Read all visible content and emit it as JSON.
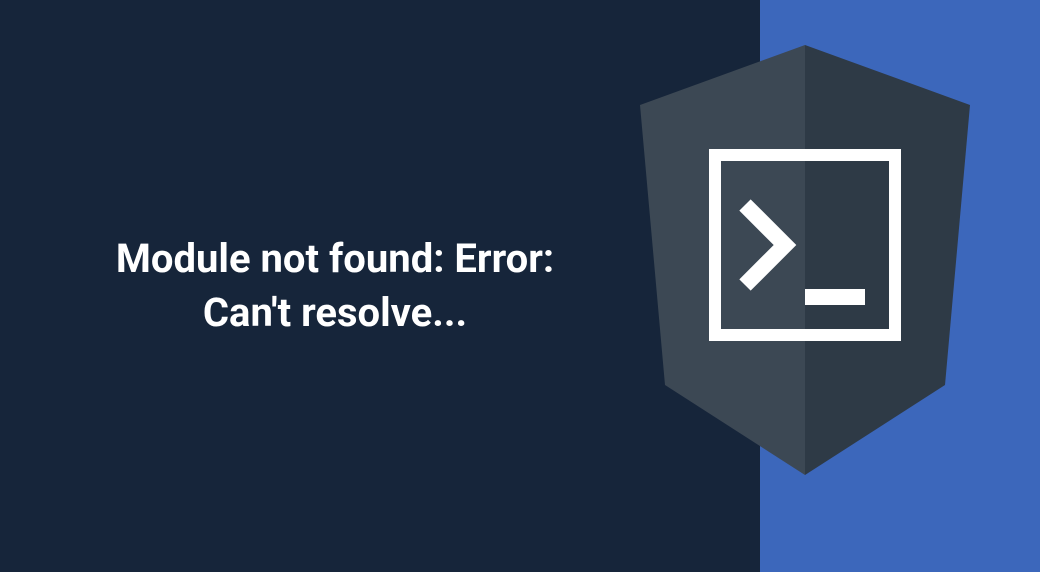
{
  "heading": {
    "line1": "Module not found: Error:",
    "line2": "Can't resolve..."
  },
  "colors": {
    "dark_bg": "#16253a",
    "blue_bg": "#3c67bb",
    "shield_left": "#3c4854",
    "shield_right": "#2e3a46",
    "icon_stroke": "#ffffff"
  },
  "icon": {
    "name": "terminal-icon"
  }
}
